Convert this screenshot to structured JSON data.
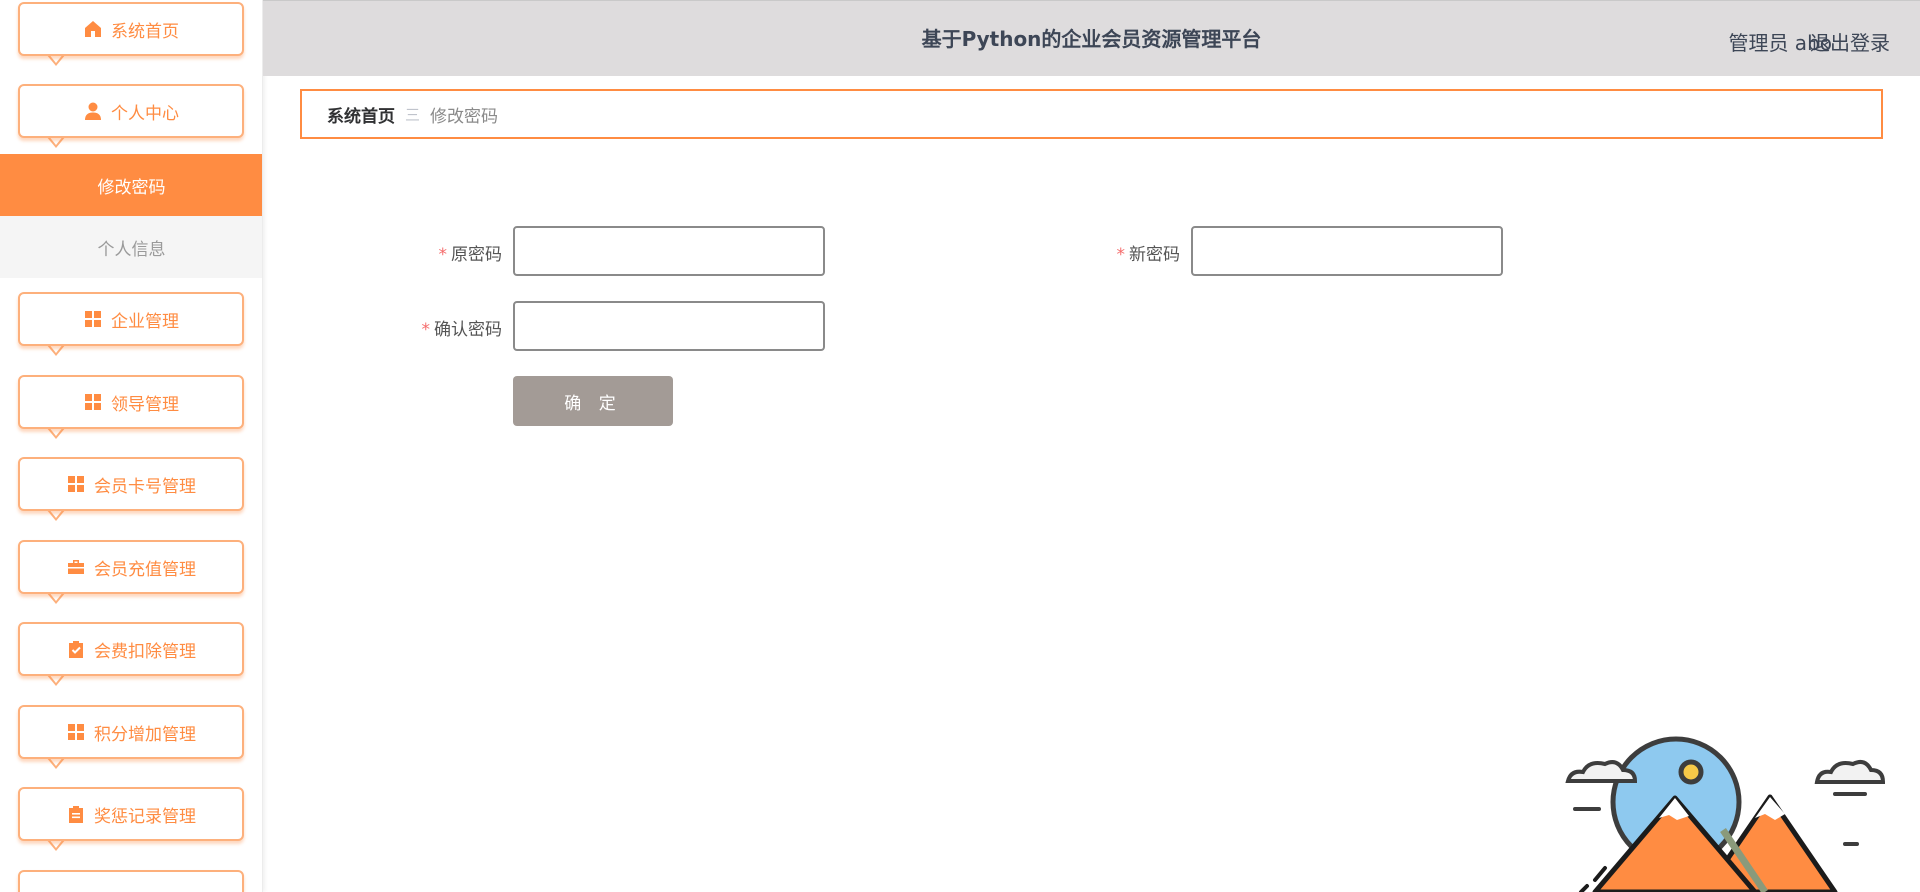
{
  "sidebar": {
    "items": [
      {
        "label": "系统首页",
        "icon": "home-icon"
      },
      {
        "label": "个人中心",
        "icon": "user-icon"
      },
      {
        "label": "企业管理",
        "icon": "grid-icon"
      },
      {
        "label": "领导管理",
        "icon": "grid-icon"
      },
      {
        "label": "会员卡号管理",
        "icon": "grid-icon"
      },
      {
        "label": "会员充值管理",
        "icon": "briefcase-icon"
      },
      {
        "label": "会费扣除管理",
        "icon": "clipboard-check-icon"
      },
      {
        "label": "积分增加管理",
        "icon": "grid-icon"
      },
      {
        "label": "奖惩记录管理",
        "icon": "clipboard-icon"
      }
    ],
    "submenu": [
      {
        "label": "修改密码",
        "active": true
      },
      {
        "label": "个人信息",
        "active": false
      }
    ]
  },
  "header": {
    "title": "基于Python的企业会员资源管理平台",
    "user": "管理员 abo",
    "logout": "退出登录"
  },
  "breadcrumb": {
    "home": "系统首页",
    "separator": "三",
    "current": "修改密码"
  },
  "form": {
    "required_mark": "*",
    "old_password_label": "原密码",
    "new_password_label": "新密码",
    "confirm_password_label": "确认密码",
    "old_password_value": "",
    "new_password_value": "",
    "confirm_password_value": "",
    "submit_label": "确 定"
  },
  "colors": {
    "accent": "#ff8c42",
    "header_bg": "#dedcdd",
    "button_bg": "#a39b96",
    "required": "#f56c6c"
  }
}
